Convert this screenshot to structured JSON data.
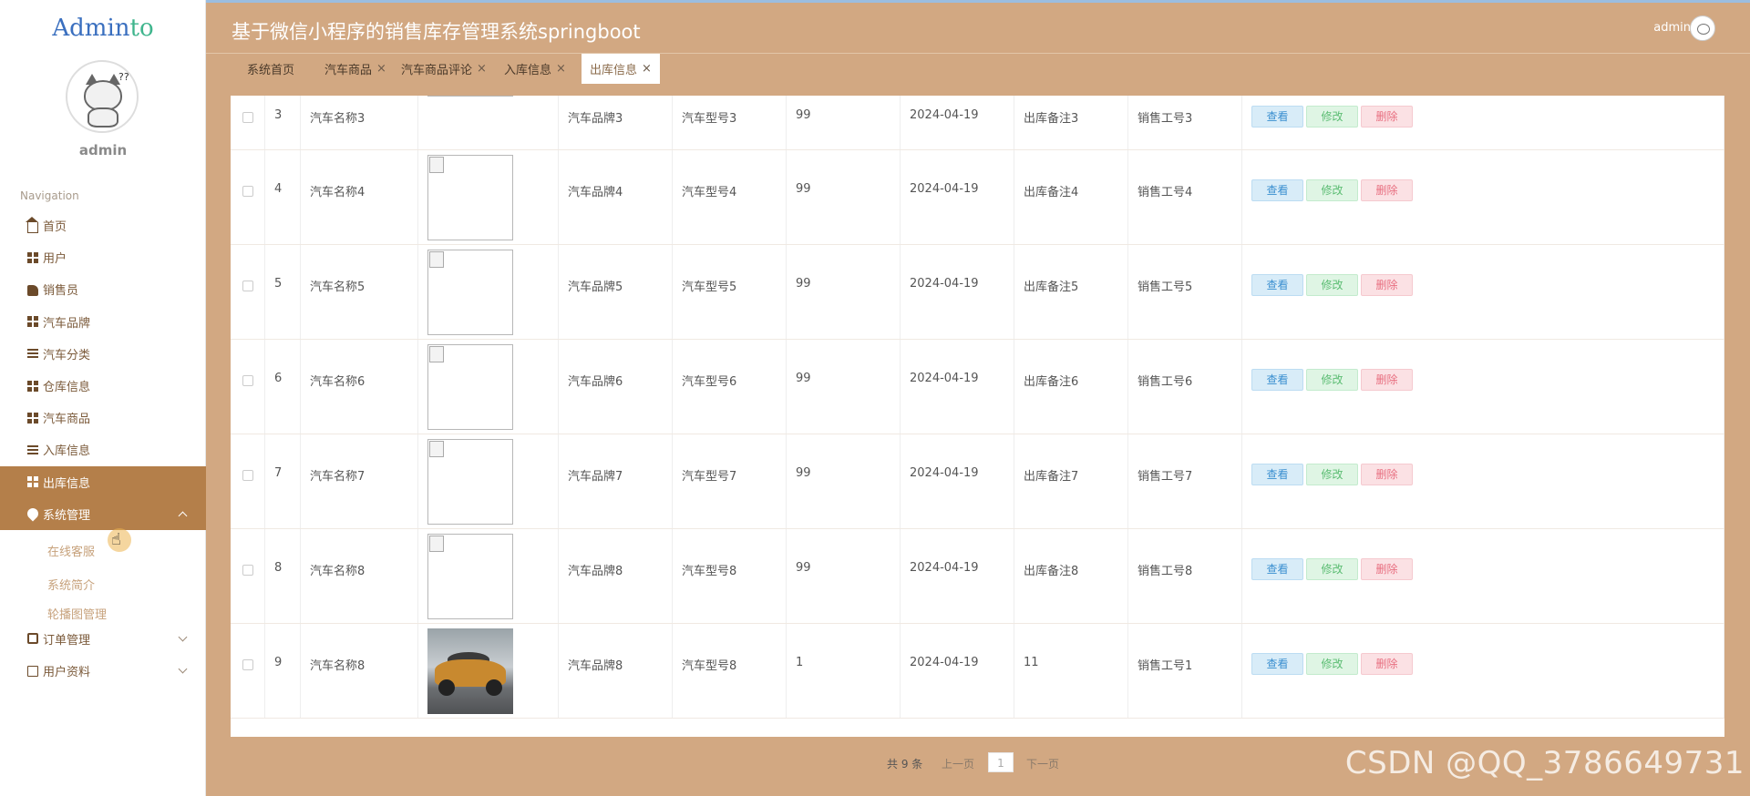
{
  "brand": {
    "part1": "Admin",
    "part2": "to"
  },
  "sidebar": {
    "username": "admin",
    "nav_title": "Navigation",
    "items": [
      {
        "label": "首页",
        "icon": "home-icon"
      },
      {
        "label": "用户",
        "icon": "grid-icon"
      },
      {
        "label": "销售员",
        "icon": "hand-icon"
      },
      {
        "label": "汽车品牌",
        "icon": "grid-icon"
      },
      {
        "label": "汽车分类",
        "icon": "list-icon"
      },
      {
        "label": "仓库信息",
        "icon": "grid-icon"
      },
      {
        "label": "汽车商品",
        "icon": "grid-icon"
      },
      {
        "label": "入库信息",
        "icon": "list-icon"
      },
      {
        "label": "出库信息",
        "icon": "grid-icon"
      },
      {
        "label": "系统管理",
        "icon": "pin-icon"
      }
    ],
    "sub_items": [
      "在线客服",
      "系统简介",
      "轮播图管理"
    ],
    "bottom_items": [
      {
        "label": "订单管理",
        "icon": "clipboard-icon"
      },
      {
        "label": "用户资料",
        "icon": "card-icon"
      }
    ]
  },
  "header": {
    "title": "基于微信小程序的销售库存管理系统springboot",
    "user": "admin"
  },
  "tabs": [
    {
      "label": "系统首页",
      "closable": false
    },
    {
      "label": "汽车商品",
      "closable": true
    },
    {
      "label": "汽车商品评论",
      "closable": true
    },
    {
      "label": "入库信息",
      "closable": true
    },
    {
      "label": "出库信息",
      "closable": true,
      "active": true
    }
  ],
  "table": {
    "rows": [
      {
        "idx": "3",
        "name": "汽车名称3",
        "image": "broken",
        "brand": "汽车品牌3",
        "model": "汽车型号3",
        "qty": "99",
        "date": "2024-04-19",
        "note": "出库备注3",
        "staff": "销售工号3"
      },
      {
        "idx": "4",
        "name": "汽车名称4",
        "image": "broken",
        "brand": "汽车品牌4",
        "model": "汽车型号4",
        "qty": "99",
        "date": "2024-04-19",
        "note": "出库备注4",
        "staff": "销售工号4"
      },
      {
        "idx": "5",
        "name": "汽车名称5",
        "image": "broken",
        "brand": "汽车品牌5",
        "model": "汽车型号5",
        "qty": "99",
        "date": "2024-04-19",
        "note": "出库备注5",
        "staff": "销售工号5"
      },
      {
        "idx": "6",
        "name": "汽车名称6",
        "image": "broken",
        "brand": "汽车品牌6",
        "model": "汽车型号6",
        "qty": "99",
        "date": "2024-04-19",
        "note": "出库备注6",
        "staff": "销售工号6"
      },
      {
        "idx": "7",
        "name": "汽车名称7",
        "image": "broken",
        "brand": "汽车品牌7",
        "model": "汽车型号7",
        "qty": "99",
        "date": "2024-04-19",
        "note": "出库备注7",
        "staff": "销售工号7"
      },
      {
        "idx": "8",
        "name": "汽车名称8",
        "image": "broken",
        "brand": "汽车品牌8",
        "model": "汽车型号8",
        "qty": "99",
        "date": "2024-04-19",
        "note": "出库备注8",
        "staff": "销售工号8"
      },
      {
        "idx": "9",
        "name": "汽车名称8",
        "image": "car-photo",
        "brand": "汽车品牌8",
        "model": "汽车型号8",
        "qty": "1",
        "date": "2024-04-19",
        "note": "11",
        "staff": "销售工号1"
      }
    ],
    "actions": {
      "view": "查看",
      "edit": "修改",
      "delete": "删除"
    }
  },
  "pager": {
    "total": "共 9 条",
    "prev": "上一页",
    "page": "1",
    "next": "下一页"
  },
  "watermark": "CSDN @QQ_3786649731",
  "colors": {
    "accent": "#d2a882",
    "active_nav": "#b47f4a"
  }
}
